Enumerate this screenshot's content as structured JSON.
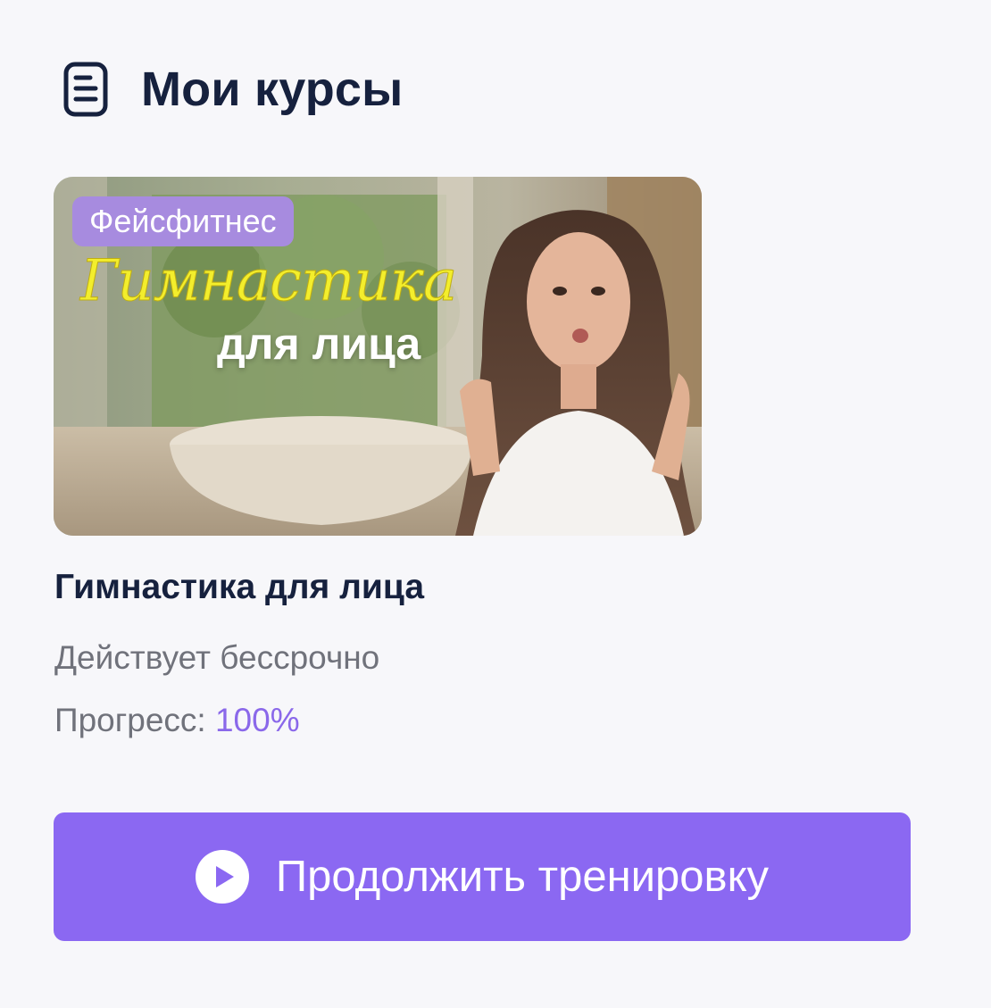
{
  "header": {
    "icon": "document-list-icon",
    "title": "Мои курсы"
  },
  "course": {
    "category": "Фейсфитнес",
    "thumbnail_title_script": "Гимнастика",
    "thumbnail_title_sub": "для лица",
    "title": "Гимнастика для лица",
    "validity": "Действует бессрочно",
    "progress_label": "Прогресс:",
    "progress_value": "100%",
    "progress_fraction": 1.0
  },
  "action": {
    "icon": "play-circle-icon",
    "label": "Продолжить тренировку"
  },
  "colors": {
    "background": "#f7f7fa",
    "primary": "#8b68f2",
    "badge": "#a78bdf",
    "text_dark": "#16213e",
    "text_muted": "#70727b",
    "progress_accent": "#8a68ea"
  }
}
